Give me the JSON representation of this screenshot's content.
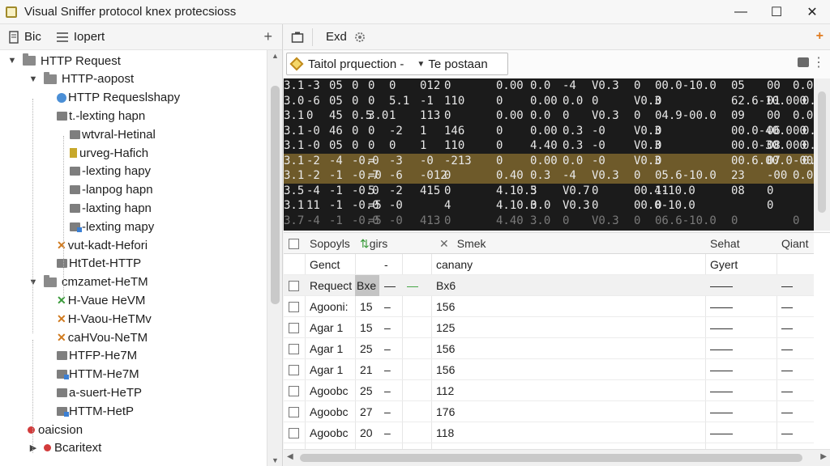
{
  "window": {
    "title": "Visual Sniffer protocol knex protecsioss",
    "controls": {
      "minimize": "—",
      "maximize": "☐",
      "close": "✕"
    }
  },
  "left_toolbar": {
    "item1": "Bic",
    "item2": "Iopert",
    "add": "+"
  },
  "tree": [
    {
      "label": "HTTP Request",
      "level": 0,
      "icon": "folder",
      "twisty": "▼"
    },
    {
      "label": "HTTP-aopost",
      "level": 1,
      "icon": "folder",
      "twisty": "▼"
    },
    {
      "label": "HTTP Requeslshapy",
      "level": 2,
      "icon": "http"
    },
    {
      "label": "t.-lexting hapn",
      "level": 2,
      "icon": "folder-small"
    },
    {
      "label": "wtvral-Hetinal",
      "level": 3,
      "icon": "folder-small"
    },
    {
      "label": "urveg-Hafich",
      "level": 3,
      "icon": "leaf"
    },
    {
      "label": "-lexting hapy",
      "level": 3,
      "icon": "folder-small"
    },
    {
      "label": "-lanpog hapn",
      "level": 3,
      "icon": "folder-small"
    },
    {
      "label": "-laxting hapn",
      "level": 3,
      "icon": "folder-small"
    },
    {
      "label": "-lexting mapy",
      "level": 3,
      "icon": "folder-blue"
    },
    {
      "label": "vut-kadt-Hefori",
      "level": 2,
      "icon": "x-orange"
    },
    {
      "label": "HtTdet-HTTP",
      "level": 2,
      "icon": "folder-small"
    },
    {
      "label": "cmzamet-HeTM",
      "level": 1,
      "icon": "folder",
      "twisty": "▼"
    },
    {
      "label": "H-Vaue HeVM",
      "level": 2,
      "icon": "x-green"
    },
    {
      "label": "H-Vaou-HeTMv",
      "level": 2,
      "icon": "x-orange"
    },
    {
      "label": "caHVou-NeTM",
      "level": 2,
      "icon": "x-orange"
    },
    {
      "label": "HTFP-He7M",
      "level": 2,
      "icon": "folder-small"
    },
    {
      "label": "HTTM-He7M",
      "level": 2,
      "icon": "folder-blue"
    },
    {
      "label": "a-suert-HeTP",
      "level": 2,
      "icon": "folder-small"
    },
    {
      "label": "HTTM-HetP",
      "level": 2,
      "icon": "folder-blue"
    },
    {
      "label": "oaicsion",
      "level": 1,
      "icon": "dot"
    },
    {
      "label": "Bcaritext",
      "level": 1,
      "icon": "dot",
      "twisty": "▶"
    }
  ],
  "right_toolbar": {
    "exec": "Exd",
    "add": "+"
  },
  "filter": {
    "selector1": "Taitol prquection -",
    "selector2": "Te postaan"
  },
  "packets": [
    {
      "cells": [
        "3.1",
        "-3",
        "05",
        "0",
        "0",
        "0",
        "012",
        "0",
        "0.00",
        "0.0",
        "-4",
        "V0.3",
        "0",
        "00.0-10.0",
        "05",
        "00",
        "0.0"
      ],
      "hl": false
    },
    {
      "cells": [
        "3.0",
        "-6",
        "05",
        "0",
        "0",
        "5.1",
        "-1",
        "110",
        "0",
        "0.00",
        "0.0",
        "0",
        "V0.3",
        "0",
        "62.6-10.0",
        "01",
        "00",
        "0.0"
      ],
      "hl": false
    },
    {
      "cells": [
        "3.1",
        "0",
        "45",
        "0.5",
        "3.0",
        "1",
        "113",
        "0",
        "0.00",
        "0.0",
        "0",
        "V0.3",
        "0",
        "04.9-00.0",
        "09",
        "00",
        "0.0"
      ],
      "hl": false
    },
    {
      "cells": [
        "3.1",
        "-0",
        "46",
        "0",
        "0",
        "-2",
        "1",
        "146",
        "0",
        "0.00",
        "0.3",
        "-0",
        "V0.3",
        "0",
        "00.0-40.0",
        "06",
        "00",
        "0.0"
      ],
      "hl": false
    },
    {
      "cells": [
        "3.1",
        "-0",
        "05",
        "0",
        "0",
        "0",
        "1",
        "110",
        "0",
        "4.40",
        "0.3",
        "-0",
        "V0.3",
        "0",
        "00.0-30.0",
        "08",
        "00",
        "0.0"
      ],
      "hl": false
    },
    {
      "cells": [
        "3.1",
        "-2",
        "-4",
        "-0.0",
        "=",
        "-3",
        "-0",
        "-213",
        "0",
        "0.00",
        "0.0",
        "-0",
        "V0.3",
        "0",
        "00.6.00.0",
        "07",
        "-00",
        "0.0"
      ],
      "hl": true
    },
    {
      "cells": [
        "3.1",
        "-2",
        "-1",
        "-0.7",
        "=0",
        "-6",
        "-012",
        "0",
        "0.40",
        "0.3",
        "-4",
        "V0.3",
        "0",
        "05.6-10.0",
        "23",
        "-00",
        "0.0"
      ],
      "hl": true
    },
    {
      "cells": [
        "3.5",
        "-4",
        "-1",
        "-0.0",
        "5",
        "-2",
        "415",
        "0",
        "4.10.3",
        "5",
        "V0.7",
        "0",
        "00.4-10.0",
        "11",
        "08",
        "0"
      ],
      "hl": false
    },
    {
      "cells": [
        "3.1",
        "11",
        "-1",
        "-0.0",
        "=5",
        "-0",
        "",
        "4",
        "4.10.3.0",
        "0",
        "V0.3",
        "0",
        "00.0-10.0",
        "0",
        "",
        "0"
      ],
      "hl": false
    },
    {
      "cells": [
        "3.7",
        "-4",
        "-1",
        "-0.0",
        "=5",
        "-0",
        "413",
        "0",
        "4.40",
        "3.0",
        "0",
        "V0.3",
        "0",
        "06.6-10.0",
        "0",
        "",
        "0"
      ],
      "hl": false,
      "fade": true
    }
  ],
  "grid": {
    "headers": [
      "Sopoyls",
      "girs",
      "Smek",
      "Sehat",
      "Qiant"
    ],
    "rows": [
      {
        "name": "Genct",
        "c2": "",
        "c3": "-",
        "c4": "canany",
        "c5": "Gyert",
        "c6": "",
        "check": false
      },
      {
        "name": "Requect",
        "c2": "Bxe",
        "c3": "—",
        "c3b": "—",
        "c4": "Bx6",
        "c5": "——",
        "c6": "—",
        "check": true,
        "selected": true
      },
      {
        "name": "Agooni:",
        "c2": "15",
        "c3": "–",
        "c4": "156",
        "c5": "——",
        "c6": "—",
        "check": true
      },
      {
        "name": "Agar 1",
        "c2": "15",
        "c3": "–",
        "c4": "125",
        "c5": "——",
        "c6": "—",
        "check": true
      },
      {
        "name": "Agar 1",
        "c2": "25",
        "c3": "–",
        "c4": "156",
        "c5": "——",
        "c6": "—",
        "check": true
      },
      {
        "name": "Agar 1",
        "c2": "21",
        "c3": "–",
        "c4": "156",
        "c5": "——",
        "c6": "—",
        "check": true
      },
      {
        "name": "Agoobc",
        "c2": "25",
        "c3": "–",
        "c4": "112",
        "c5": "——",
        "c6": "—",
        "check": true
      },
      {
        "name": "Agoobc",
        "c2": "27",
        "c3": "–",
        "c4": "176",
        "c5": "——",
        "c6": "—",
        "check": true
      },
      {
        "name": "Agoobc",
        "c2": "20",
        "c3": "–",
        "c4": "118",
        "c5": "——",
        "c6": "—",
        "check": true
      }
    ]
  }
}
